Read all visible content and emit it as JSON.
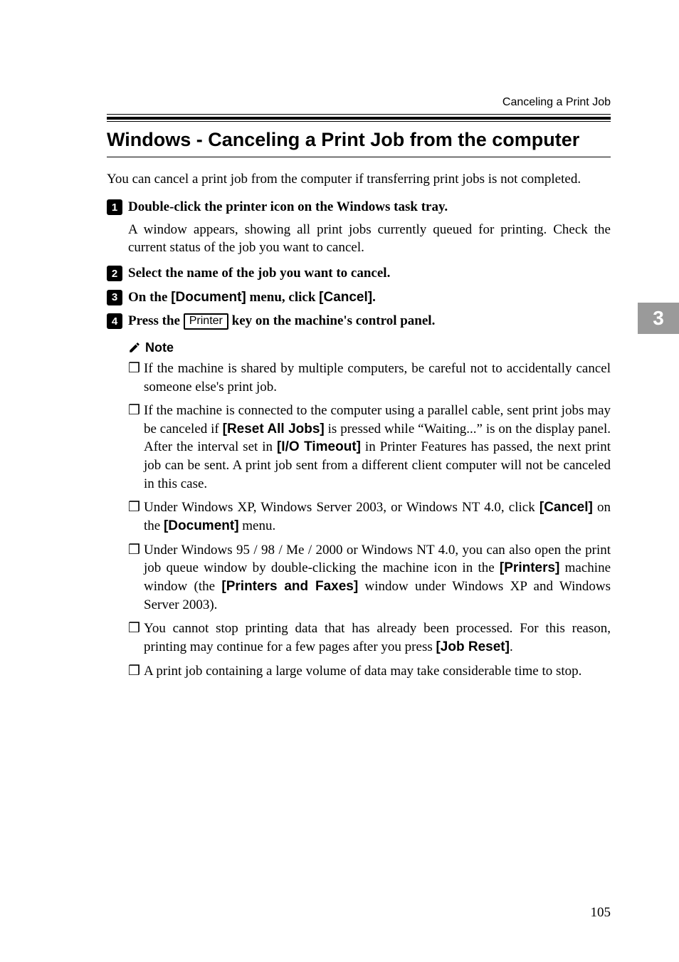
{
  "header": "Canceling a Print Job",
  "sidetab": "3",
  "title": "Windows - Canceling a Print Job from the computer",
  "intro": "You can cancel a print job from the computer if transferring print jobs is not completed.",
  "steps": {
    "s1": {
      "num": "1",
      "text": "Double-click the printer icon on the Windows task tray.",
      "body": "A window appears, showing all print jobs currently queued for printing. Check the current status of the job you want to cancel."
    },
    "s2": {
      "num": "2",
      "text": "Select the name of the job you want to cancel."
    },
    "s3": {
      "num": "3",
      "a": "On the ",
      "b": "[Document]",
      "c": " menu, click ",
      "d": "[Cancel]",
      "e": "."
    },
    "s4": {
      "num": "4",
      "a": "Press the ",
      "key": "Printer",
      "b": " key on the machine's control panel."
    }
  },
  "note_label": "Note",
  "bullets": {
    "b1": "If the machine is shared by multiple computers, be careful not to accidentally cancel someone else's print job.",
    "b2": {
      "a": "If the machine is connected to the computer using a parallel cable, sent print jobs may be canceled if ",
      "b": "[Reset All Jobs]",
      "c": " is pressed while “Waiting...” is on the display panel. After the interval set in ",
      "d": "[I/O Timeout]",
      "e": " in Printer Features has passed, the next print job can be sent. A print job sent from a different client computer will not be canceled in this case."
    },
    "b3": {
      "a": "Under Windows XP, Windows Server 2003, or Windows NT 4.0, click ",
      "b": "[Cancel]",
      "c": " on the ",
      "d": "[Document]",
      "e": " menu."
    },
    "b4": {
      "a": "Under Windows 95 / 98 / Me / 2000 or Windows NT 4.0, you can also open the print job queue window by double-clicking the machine icon in the ",
      "b": "[Printers]",
      "c": " machine window (the ",
      "d": "[Printers and Faxes]",
      "e": " window under Windows XP and Windows Server 2003)."
    },
    "b5": {
      "a": "You cannot stop printing data that has already been processed. For this reason, printing may continue for a few pages after you press ",
      "b": "[Job Reset]",
      "c": "."
    },
    "b6": "A print job containing a large volume of data may take considerable time to stop."
  },
  "page_number": "105"
}
